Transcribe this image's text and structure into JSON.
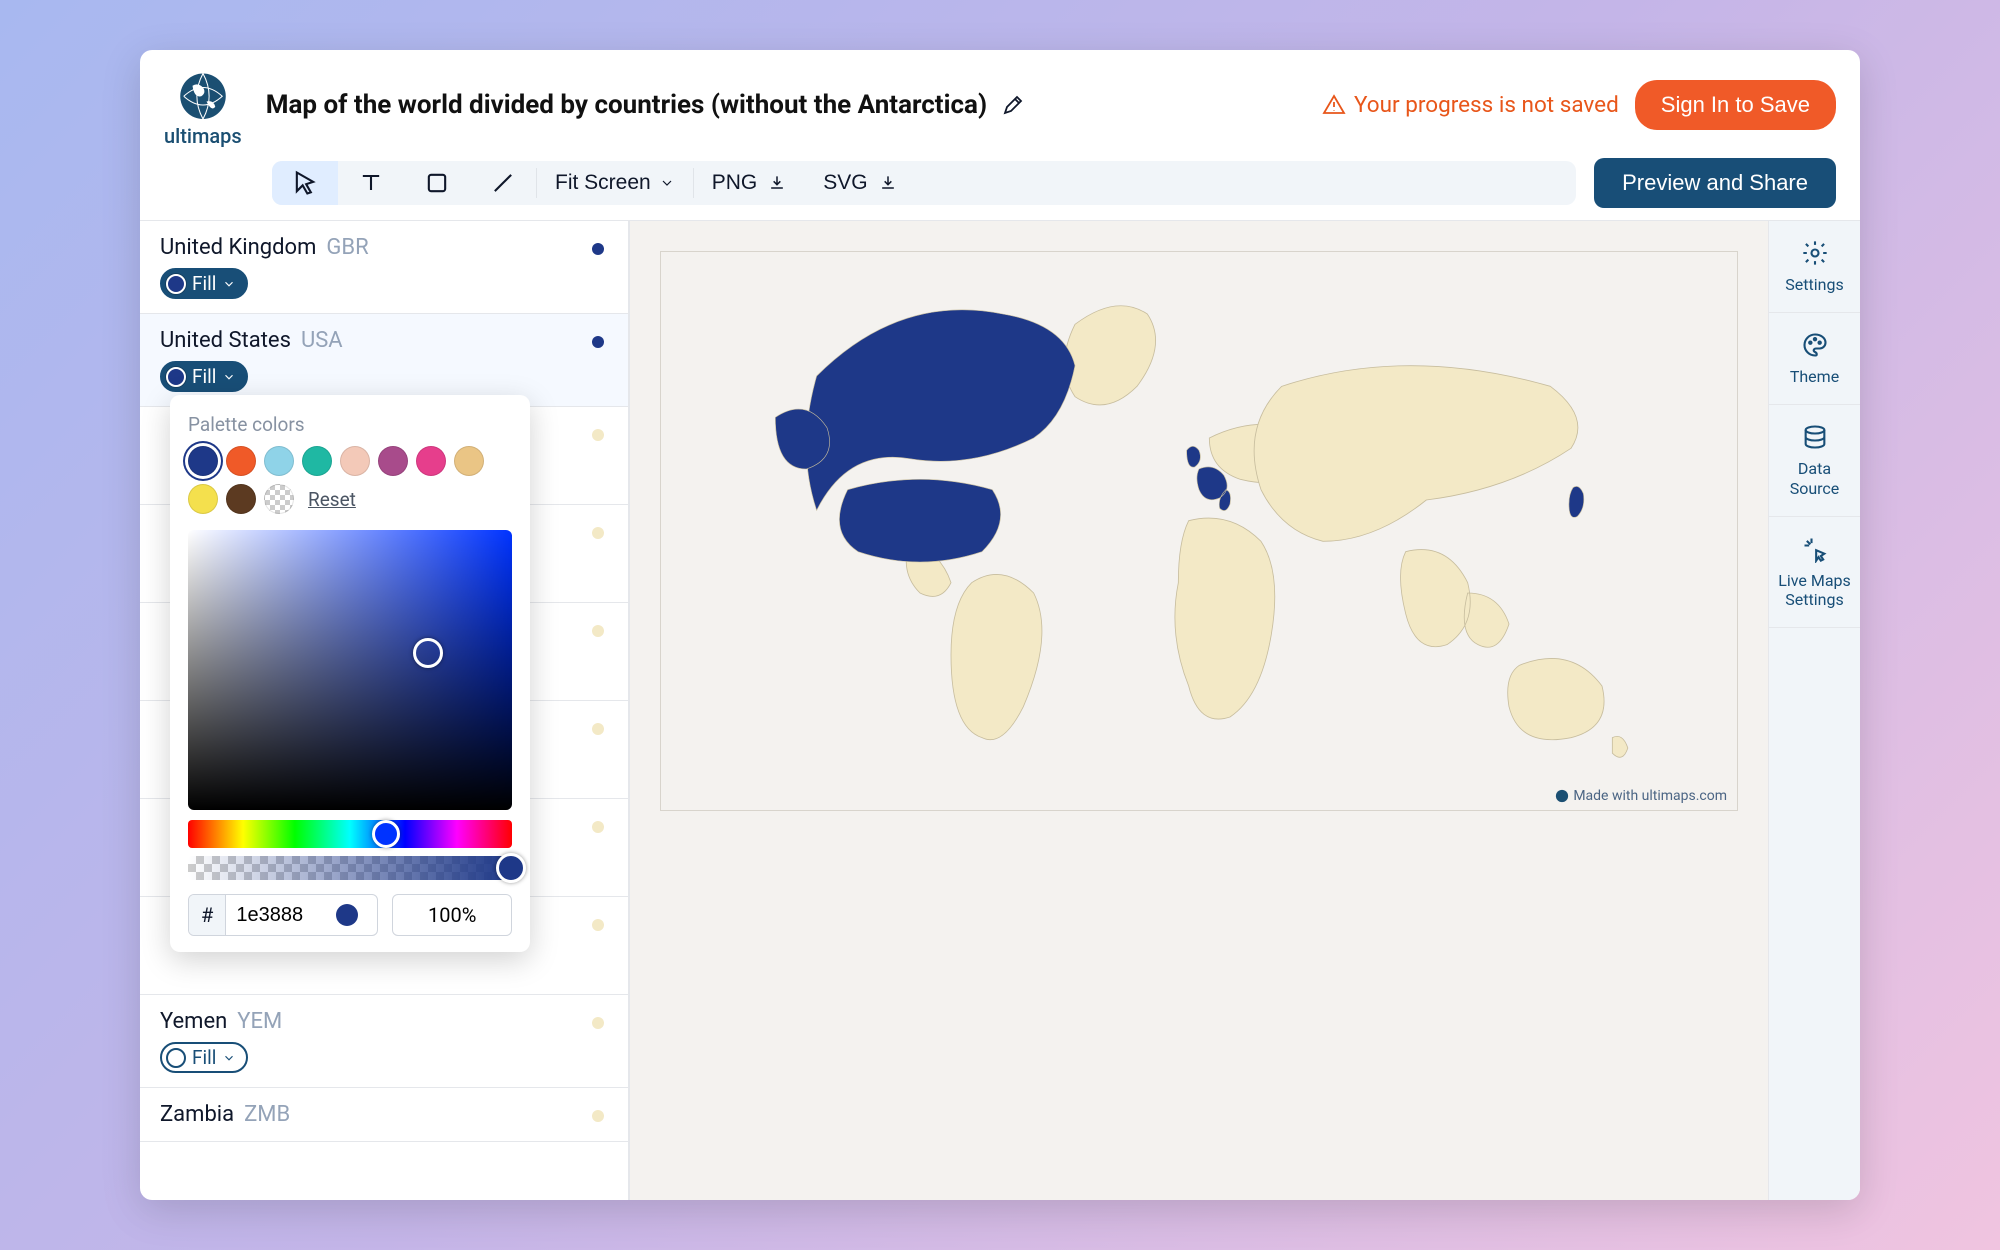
{
  "logo_text": "ultimaps",
  "page_title": "Map of the world divided by countries (without the Antarctica)",
  "warning_text": "Your progress is not saved",
  "signin_label": "Sign In to Save",
  "fit_label": "Fit Screen",
  "png_label": "PNG",
  "svg_label": "SVG",
  "preview_label": "Preview and Share",
  "countries": [
    {
      "name": "United Kingdom",
      "code": "GBR",
      "dot": "#1e3888",
      "filled": true
    },
    {
      "name": "United States",
      "code": "USA",
      "dot": "#1e3888",
      "filled": true,
      "selected": true
    },
    {
      "name": "Yemen",
      "code": "YEM",
      "dot": "#f3e9c6",
      "filled": false
    },
    {
      "name": "Zambia",
      "code": "ZMB",
      "dot": "#f3e9c6",
      "filled": false
    }
  ],
  "fill_label": "Fill",
  "palette_label": "Palette colors",
  "palette": [
    {
      "c": "#1e3888",
      "sel": true
    },
    {
      "c": "#f05a28"
    },
    {
      "c": "#8fd3e8"
    },
    {
      "c": "#1fb8a3"
    },
    {
      "c": "#f3c9b8"
    },
    {
      "c": "#a84b8b"
    },
    {
      "c": "#e63e8c"
    },
    {
      "c": "#eac585"
    },
    {
      "c": "#f4e04d"
    },
    {
      "c": "#5c3a21"
    },
    {
      "checker": true
    }
  ],
  "reset_label": "Reset",
  "hex_value": "1e3888",
  "alpha_value": "100%",
  "map_credit": "Made with ultimaps.com",
  "rail": {
    "settings": "Settings",
    "theme": "Theme",
    "data_source": "Data\nSource",
    "live": "Live Maps\nSettings"
  }
}
